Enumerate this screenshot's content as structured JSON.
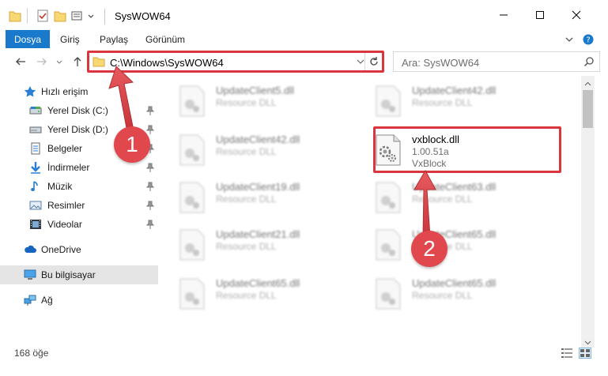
{
  "window": {
    "title": "SysWOW64",
    "controls": {
      "minimize": "minimize-icon",
      "maximize": "maximize-icon",
      "close": "close-icon"
    }
  },
  "ribbon": {
    "tabs": [
      "Dosya",
      "Giriş",
      "Paylaş",
      "Görünüm"
    ]
  },
  "navigation": {
    "address": "C:\\Windows\\SysWOW64",
    "search_placeholder": "Ara: SysWOW64"
  },
  "sidebar": {
    "quick_access": "Hızlı erişim",
    "items": [
      {
        "label": "Yerel Disk (C:)",
        "icon": "drive-icon"
      },
      {
        "label": "Yerel Disk (D:)",
        "icon": "drive-icon"
      },
      {
        "label": "Belgeler",
        "icon": "documents-icon"
      },
      {
        "label": "İndirmeler",
        "icon": "downloads-icon"
      },
      {
        "label": "Müzik",
        "icon": "music-icon"
      },
      {
        "label": "Resimler",
        "icon": "pictures-icon"
      },
      {
        "label": "Videolar",
        "icon": "videos-icon"
      }
    ],
    "onedrive": "OneDrive",
    "this_pc": "Bu bilgisayar",
    "network": "Ağ"
  },
  "files": {
    "left_column": [
      {
        "name": "UpdateClient5.dll",
        "type": "Resource DLL"
      },
      {
        "name": "UpdateClient42.dll",
        "type": "Resource DLL"
      },
      {
        "name": "UpdateClient19.dll",
        "type": "Resource DLL"
      },
      {
        "name": "UpdateClient21.dll",
        "type": "Resource DLL"
      },
      {
        "name": "UpdateClient65.dll",
        "type": "Resource DLL"
      }
    ],
    "right_column": [
      {
        "name": "UpdateClient42.dll",
        "type": "Resource DLL"
      },
      {
        "name": "vxblock.dll",
        "version": "1.00.51a",
        "product": "VxBlock"
      },
      {
        "name": "UpdateClient63.dll",
        "type": "Resource DLL"
      },
      {
        "name": "UpdateClient65.dll",
        "type": "Resource DLL"
      },
      {
        "name": "UpdateClient65.dll",
        "type": "Resource DLL"
      }
    ]
  },
  "status": {
    "item_count": "168 öğe"
  },
  "annotations": {
    "step1": "1",
    "step2": "2"
  },
  "colors": {
    "accent": "#1979ca",
    "highlight": "#d9363e",
    "selected": "#cce8ff"
  }
}
